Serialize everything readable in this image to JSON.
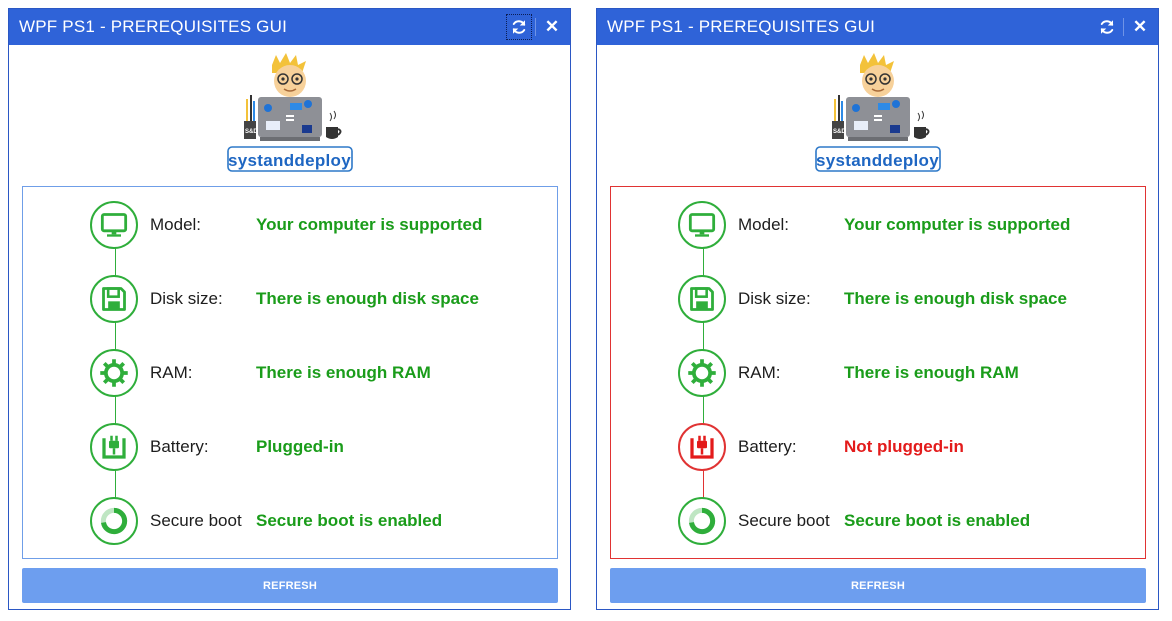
{
  "colors": {
    "titlebar": "#2f63d8",
    "ok": "#2fae3b",
    "ok_text": "#1a9c1a",
    "bad": "#e31b1b",
    "button": "#6d9eef"
  },
  "windows": [
    {
      "title": "WPF PS1 - PREREQUISITES GUI",
      "logo_text": "systanddeploy",
      "refresh_label": "REFRESH",
      "close_glyph": "✕",
      "rows": [
        {
          "label": "Model:",
          "status": "Your computer is supported",
          "state": "ok",
          "icon": "monitor-icon"
        },
        {
          "label": "Disk size:",
          "status": "There is enough disk space",
          "state": "ok",
          "icon": "floppy-disk-icon"
        },
        {
          "label": "RAM:",
          "status": "There is enough RAM",
          "state": "ok",
          "icon": "gear-icon"
        },
        {
          "label": "Battery:",
          "status": "Plugged-in",
          "state": "ok",
          "icon": "plug-icon"
        },
        {
          "label": "Secure boot",
          "status": "Secure boot is enabled",
          "state": "ok",
          "icon": "secure-boot-ring-icon"
        }
      ]
    },
    {
      "title": "WPF PS1 - PREREQUISITES GUI",
      "logo_text": "systanddeploy",
      "refresh_label": "REFRESH",
      "close_glyph": "✕",
      "rows": [
        {
          "label": "Model:",
          "status": "Your computer is supported",
          "state": "ok",
          "icon": "monitor-icon"
        },
        {
          "label": "Disk size:",
          "status": "There is enough disk space",
          "state": "ok",
          "icon": "floppy-disk-icon"
        },
        {
          "label": "RAM:",
          "status": "There is enough RAM",
          "state": "ok",
          "icon": "gear-icon"
        },
        {
          "label": "Battery:",
          "status": "Not plugged-in",
          "state": "bad",
          "icon": "plug-icon"
        },
        {
          "label": "Secure boot",
          "status": "Secure boot is enabled",
          "state": "ok",
          "icon": "secure-boot-ring-icon"
        }
      ]
    }
  ]
}
